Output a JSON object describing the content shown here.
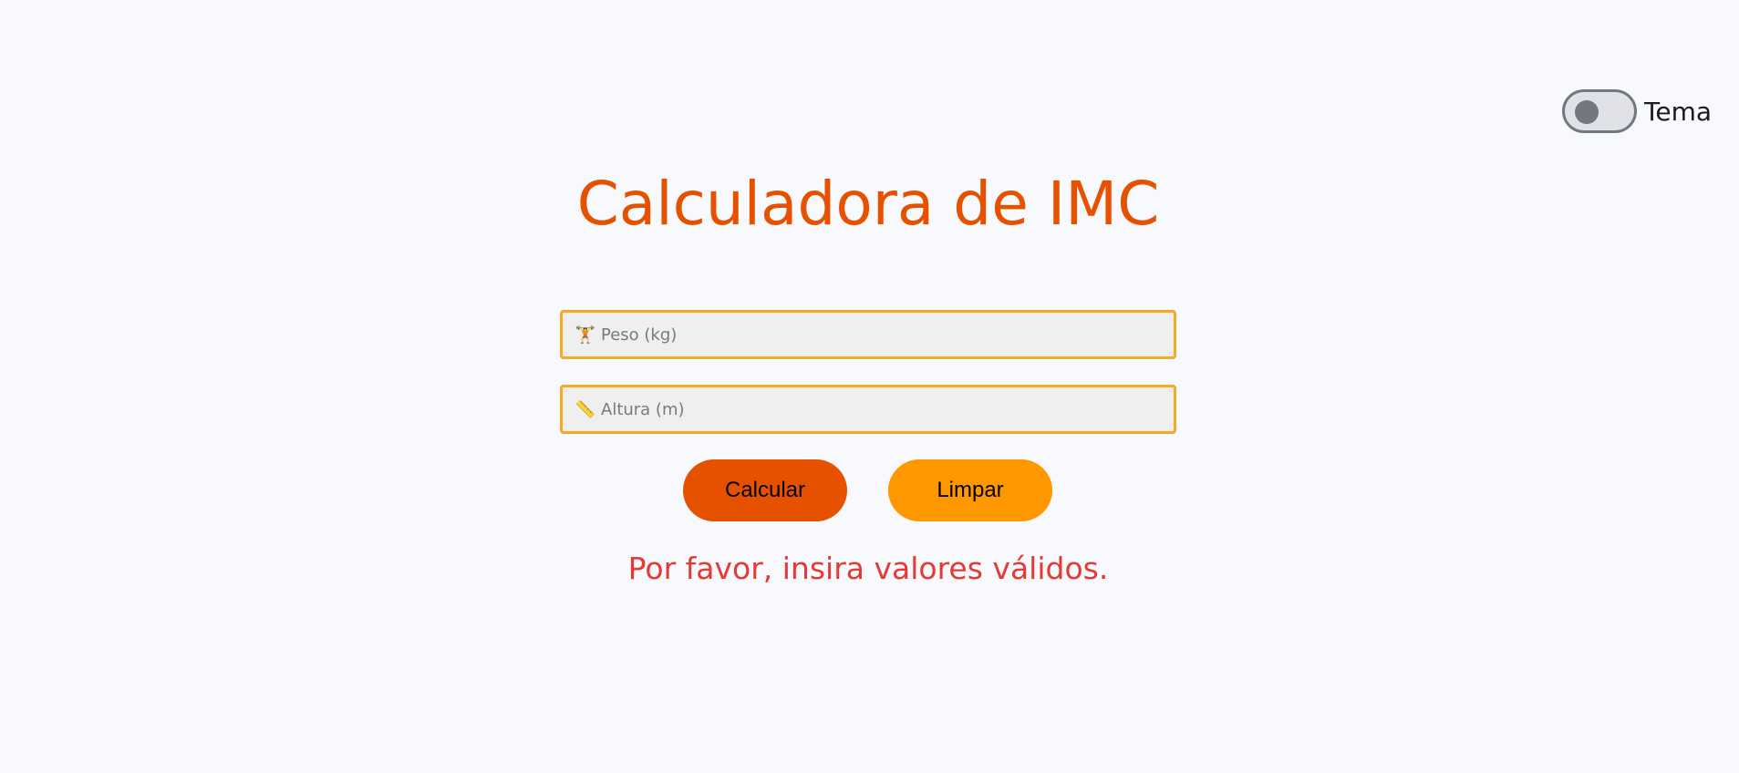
{
  "theme_toggle": {
    "label": "Tema",
    "state": "off"
  },
  "title": "Calculadora de IMC",
  "inputs": {
    "weight": {
      "icon": "weightlifter-icon",
      "icon_glyph": "🏋",
      "placeholder": "Peso (kg)",
      "value": ""
    },
    "height": {
      "icon": "ruler-icon",
      "icon_glyph": "📏",
      "placeholder": "Altura (m)",
      "value": ""
    }
  },
  "buttons": {
    "calculate": "Calcular",
    "clear": "Limpar"
  },
  "message": "Por favor, insira valores válidos.",
  "colors": {
    "accent": "#e65100",
    "secondary": "#ff9800",
    "field_border": "#f9a825",
    "error": "#e53935"
  }
}
